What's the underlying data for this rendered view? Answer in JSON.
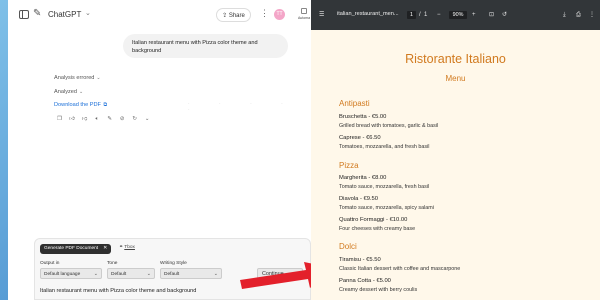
{
  "chatgpt": {
    "title": "ChatGPT",
    "share_label": "Share",
    "avatar_text": "TT",
    "right_tag": "Automa",
    "user_message": "Italian restaurant menu with Pizza color theme and background",
    "analysis_errored": "Analysis errored",
    "analyzed": "Analyzed",
    "download_link": "Download the PDF",
    "plugin": {
      "pill_label": "Generate PDF Document",
      "tbox_label": "Tbox",
      "output_label": "Output in",
      "output_value": "Default language",
      "tone_label": "Tone",
      "tone_value": "Default",
      "style_label": "Writing Style",
      "style_value": "Default",
      "continue_label": "Continue"
    },
    "composer_text": "Italian restaurant menu with Pizza color theme and background"
  },
  "pdf_viewer": {
    "file_name": "italian_restaurant_men...",
    "page_current": "1",
    "page_sep": "/",
    "page_total": "1",
    "zoom": "90%"
  },
  "menu": {
    "title": "Ristorante Italiano",
    "subtitle": "Menu",
    "sections": [
      {
        "name": "Antipasti",
        "items": [
          {
            "name": "Bruschetta - €5.00",
            "desc": "Grilled bread with tomatoes, garlic & basil"
          },
          {
            "name": "Caprese - €6.50",
            "desc": "Tomatoes, mozzarella, and fresh basil"
          }
        ]
      },
      {
        "name": "Pizza",
        "items": [
          {
            "name": "Margherita - €8.00",
            "desc": "Tomato sauce, mozzarella, fresh basil"
          },
          {
            "name": "Diavola - €9.50",
            "desc": "Tomato sauce, mozzarella, spicy salami"
          },
          {
            "name": "Quattro Formaggi - €10.00",
            "desc": "Four cheeses with creamy base"
          }
        ]
      },
      {
        "name": "Dolci",
        "items": [
          {
            "name": "Tiramisu - €5.50",
            "desc": "Classic Italian dessert with coffee and mascarpone"
          },
          {
            "name": "Panna Cotta - €5.00",
            "desc": "Creamy dessert with berry coulis"
          }
        ]
      }
    ]
  },
  "colors": {
    "accent_orange": "#d17a1f",
    "page_bg": "#fff8ea",
    "viewer_toolbar": "#323639",
    "link_blue": "#1a6fd8",
    "arrow_red": "#e3202b"
  }
}
